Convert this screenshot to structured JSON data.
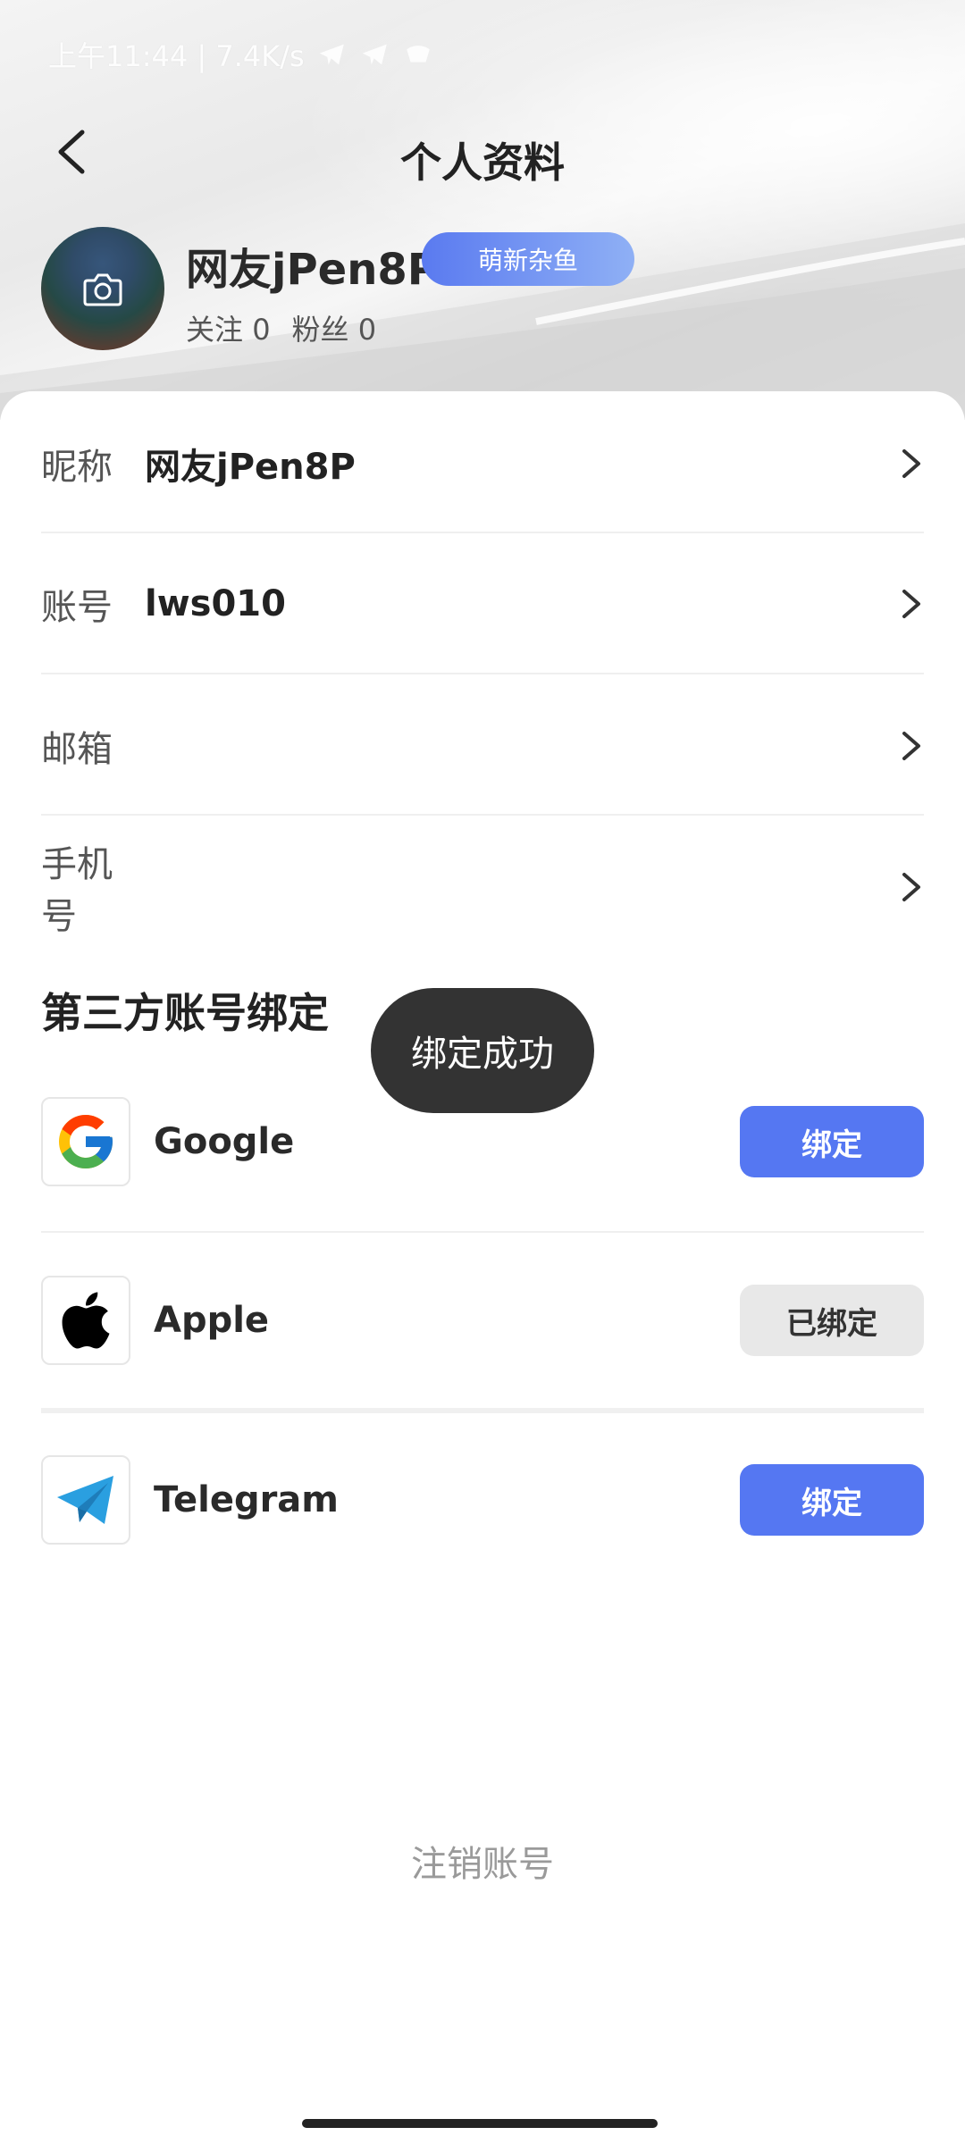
{
  "status_bar": {
    "time_speed": "上午11:44 | 7.4K/s"
  },
  "header": {
    "title": "个人资料"
  },
  "profile": {
    "name": "网友jPen8P",
    "badge": "萌新杂鱼",
    "following_label": "关注",
    "following_count": "0",
    "fans_label": "粉丝",
    "fans_count": "0"
  },
  "info_rows": [
    {
      "label": "昵称",
      "value": "网友jPen8P"
    },
    {
      "label": "账号",
      "value": "lws010"
    },
    {
      "label": "邮箱",
      "value": ""
    },
    {
      "label": "手机号",
      "value": ""
    }
  ],
  "third_party": {
    "title": "第三方账号绑定",
    "items": [
      {
        "name": "Google",
        "button": "绑定",
        "icon": "google-icon"
      },
      {
        "name": "Apple",
        "button": "已绑定",
        "icon": "apple-icon"
      },
      {
        "name": "Telegram",
        "button": "绑定",
        "icon": "telegram-icon"
      }
    ]
  },
  "toast": {
    "text": "绑定成功"
  },
  "footer": {
    "delete_account": "注销账号"
  },
  "colors": {
    "accent": "#5577f2",
    "toast_bg": "#333333",
    "bound_bg": "#e8e8e8"
  }
}
